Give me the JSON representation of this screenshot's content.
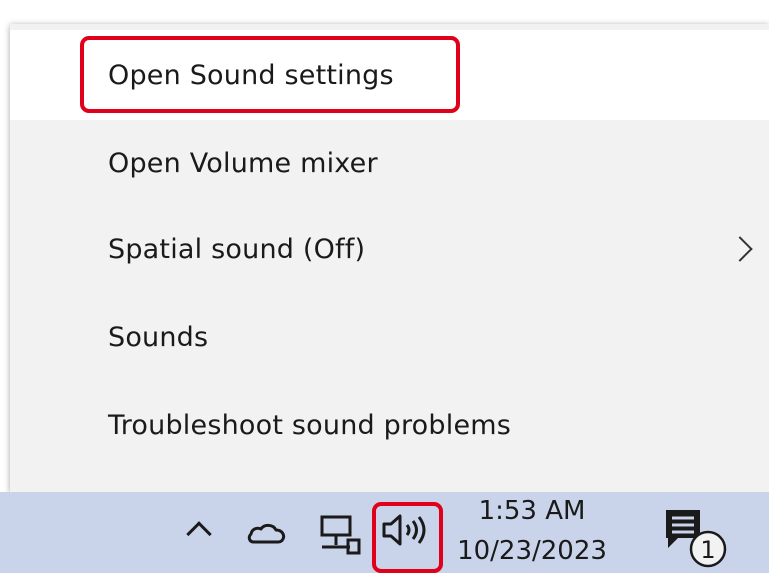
{
  "menu": {
    "items": [
      {
        "label": "Open Sound settings",
        "state": "hovered"
      },
      {
        "label": "Open Volume mixer"
      },
      {
        "label": "Spatial sound (Off)",
        "has_submenu": true
      },
      {
        "label": "Sounds"
      },
      {
        "label": "Troubleshoot sound problems"
      }
    ]
  },
  "taskbar": {
    "icons": [
      "chevron-up-icon",
      "cloud-icon",
      "network-icon",
      "volume-icon",
      "notification-icon"
    ],
    "clock": {
      "time": "1:53 AM",
      "date": "10/23/2023"
    },
    "notification_count": "1"
  },
  "colors": {
    "highlight": "#e1001a",
    "menu_background": "#f2f2f2",
    "hover_background": "#ffffff",
    "taskbar_background": "#c9d3ea"
  }
}
